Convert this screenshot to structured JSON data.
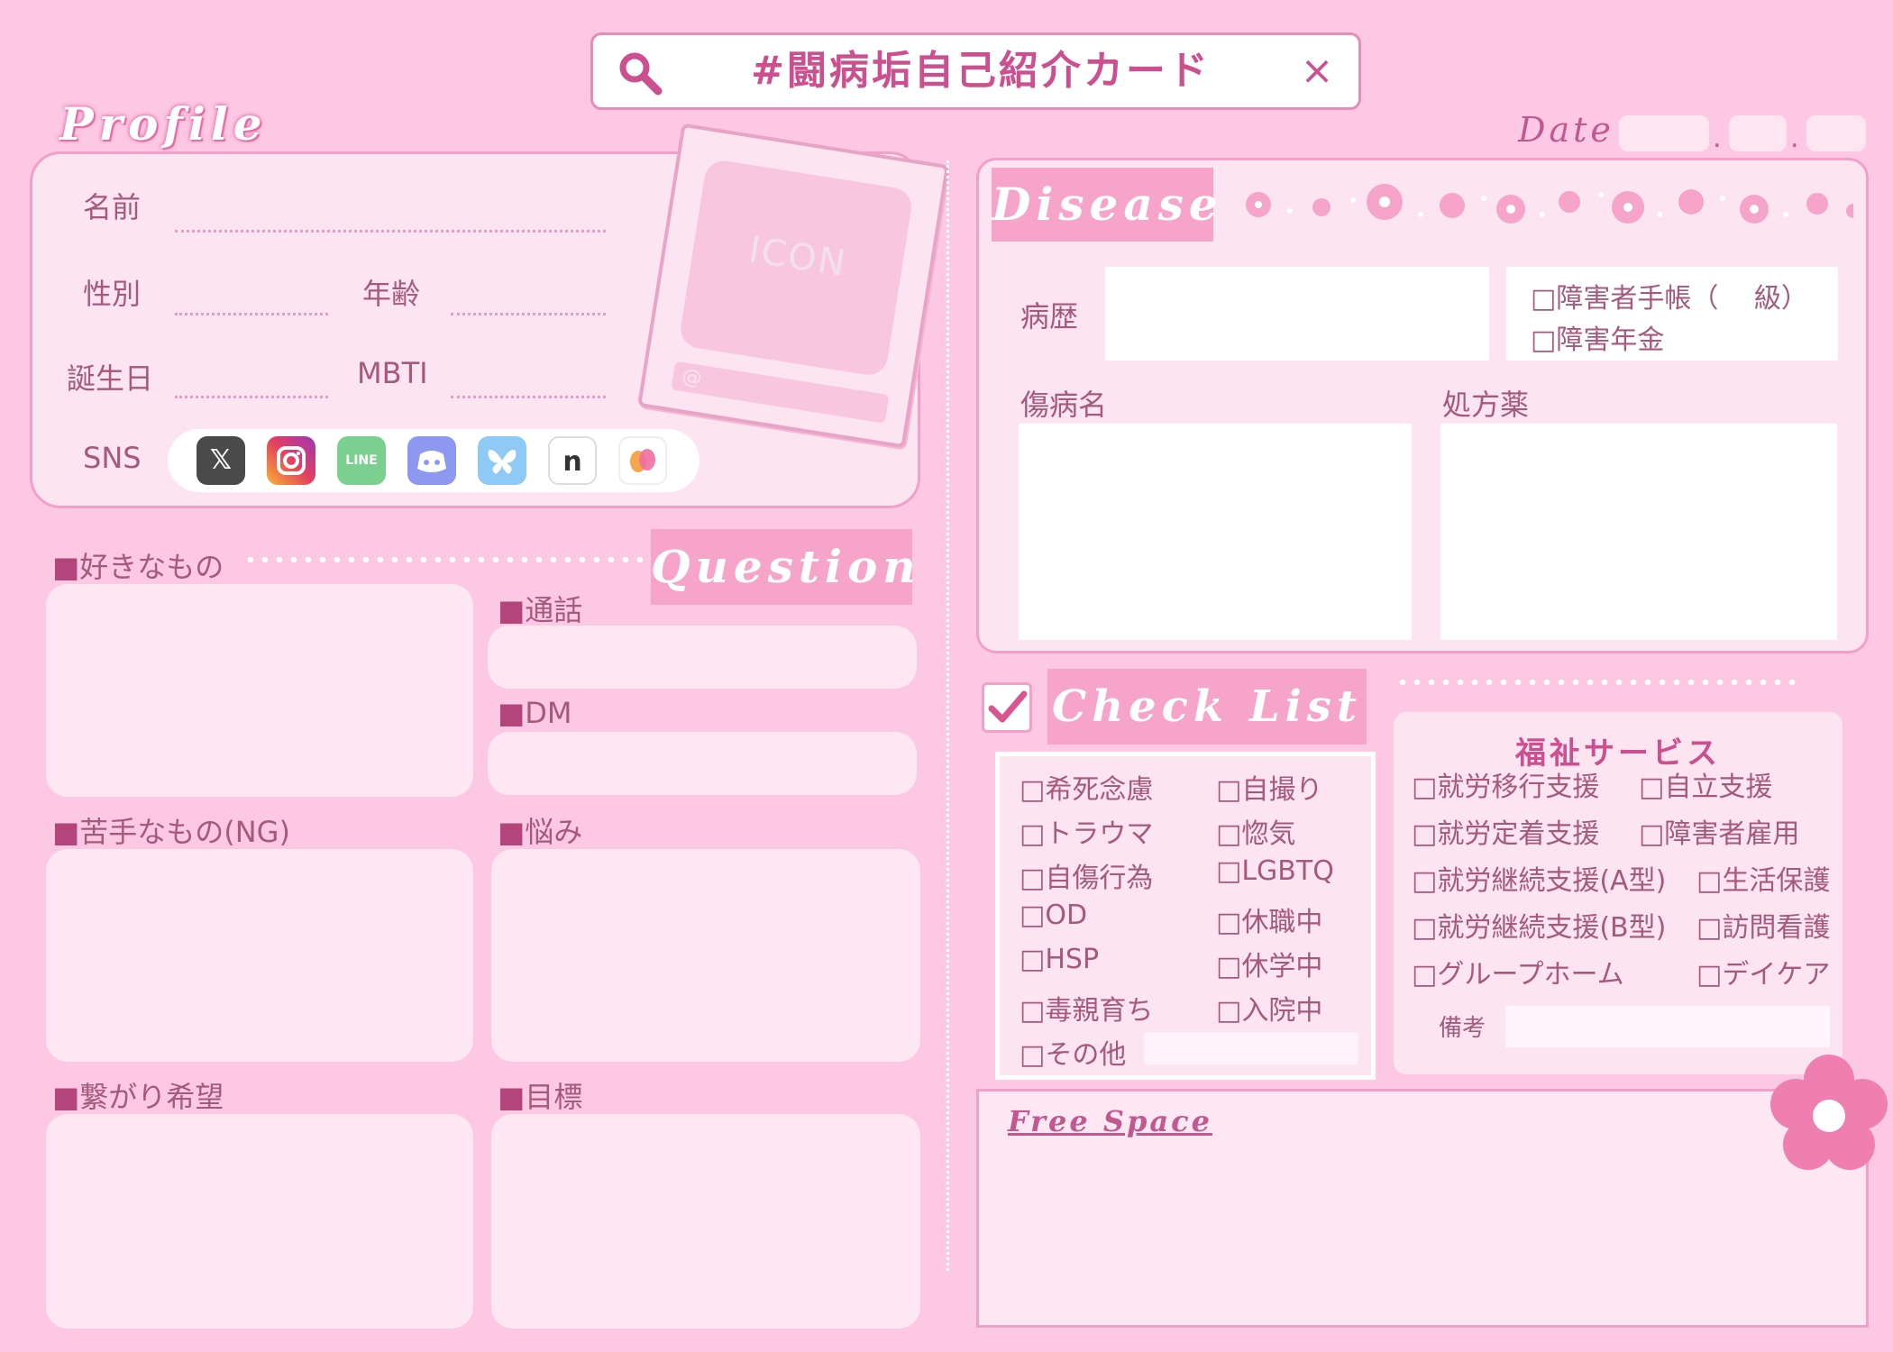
{
  "search": {
    "title": "#闘病垢自己紹介カード",
    "close": "×"
  },
  "profile": {
    "title": "Profile",
    "fields": {
      "name": "名前",
      "gender": "性別",
      "age": "年齢",
      "birthday": "誕生日",
      "mbti": "MBTI",
      "sns": "SNS"
    },
    "polaroid": {
      "icon_label": "ICON",
      "handle_label": "@"
    },
    "sns_icons": [
      "x-icon",
      "instagram-icon",
      "line-icon",
      "discord-icon",
      "bluesky-icon",
      "note-icon",
      "other-sns-icon"
    ]
  },
  "date": {
    "label": "Date",
    "sep": "."
  },
  "left_sections": {
    "likes": "好きなもの",
    "dislikes": "苦手なもの(NG)",
    "connections": "繋がり希望",
    "square": "■"
  },
  "question": {
    "title": "Question",
    "call": "通話",
    "dm": "DM",
    "worries": "悩み",
    "goals": "目標"
  },
  "disease": {
    "title": "Disease",
    "history": "病歴",
    "cert_1": "□障害者手帳（　 級）",
    "cert_2": "□障害年金",
    "diagnosis": "傷病名",
    "prescription": "処方薬"
  },
  "checklist": {
    "title": "Check List",
    "col1": [
      "□希死念慮",
      "□トラウマ",
      "□自傷行為",
      "□OD",
      "□HSP",
      "□毒親育ち",
      "□その他"
    ],
    "col2": [
      "□自撮り",
      "□惚気",
      "□LGBTQ",
      "□休職中",
      "□休学中",
      "□入院中"
    ]
  },
  "welfare": {
    "title": "福祉サービス",
    "col1": [
      "□就労移行支援",
      "□就労定着支援",
      "□就労継続支援(A型)",
      "□就労継続支援(B型)",
      "□グループホーム"
    ],
    "col2": [
      "□自立支援",
      "□障害者雇用",
      "□生活保護",
      "□訪問看護",
      "□デイケア"
    ],
    "notes": "備考"
  },
  "free_space": {
    "title": "Free Space"
  },
  "colors": {
    "background": "#fcc8e4",
    "accent": "#cc4f8f",
    "tab": "#f7a4ca",
    "card": "#fde4f1"
  }
}
